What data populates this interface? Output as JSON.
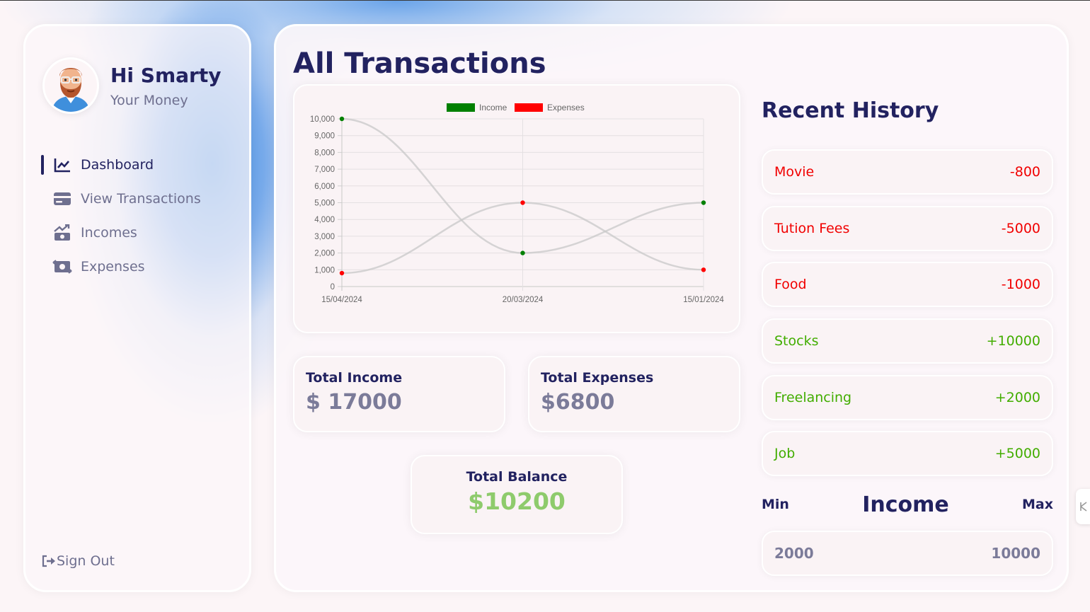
{
  "profile": {
    "greeting": "Hi Smarty",
    "subtitle": "Your Money",
    "avatar_icon": "avatar-icon"
  },
  "menu": [
    {
      "label": "Dashboard",
      "icon": "line-chart-icon",
      "active": true
    },
    {
      "label": "View Transactions",
      "icon": "credit-card-icon",
      "active": false
    },
    {
      "label": "Incomes",
      "icon": "money-bill-trend-up-icon",
      "active": false
    },
    {
      "label": "Expenses",
      "icon": "money-bill-transfer-icon",
      "active": false
    }
  ],
  "signout": {
    "label": "Sign Out",
    "icon": "sign-out-icon"
  },
  "main": {
    "title": "All Transactions",
    "total_income": {
      "label": "Total Income",
      "value": "$ 17000"
    },
    "total_expenses": {
      "label": "Total Expenses",
      "value": "$6800"
    },
    "total_balance": {
      "label": "Total Balance",
      "value": "$10200"
    }
  },
  "history": {
    "title": "Recent History",
    "items": [
      {
        "name": "Movie",
        "amount": "-800",
        "type": "expense"
      },
      {
        "name": "Tution Fees",
        "amount": "-5000",
        "type": "expense"
      },
      {
        "name": "Food",
        "amount": "-1000",
        "type": "expense"
      },
      {
        "name": "Stocks",
        "amount": "+10000",
        "type": "income"
      },
      {
        "name": "Freelancing",
        "amount": "+2000",
        "type": "income"
      },
      {
        "name": "Job",
        "amount": "+5000",
        "type": "income"
      }
    ]
  },
  "range": {
    "min_label": "Min",
    "title": "Income",
    "max_label": "Max",
    "min_value": "2000",
    "max_value": "10000"
  },
  "colors": {
    "income": "#008000",
    "expense": "#ff0000",
    "navy": "#222260",
    "balance": "#8ecb6c"
  },
  "chart_data": {
    "type": "line",
    "x": [
      "15/04/2024",
      "20/03/2024",
      "15/01/2024"
    ],
    "series": [
      {
        "name": "Income",
        "values": [
          10000,
          2000,
          5000
        ],
        "color": "#008000"
      },
      {
        "name": "Expenses",
        "values": [
          800,
          5000,
          1000
        ],
        "color": "#ff0000"
      }
    ],
    "ylim": [
      0,
      10000
    ],
    "yticks": [
      "0",
      "1,000",
      "2,000",
      "3,000",
      "4,000",
      "5,000",
      "6,000",
      "7,000",
      "8,000",
      "9,000",
      "10,000"
    ],
    "grid": true,
    "legend": "top-center"
  }
}
